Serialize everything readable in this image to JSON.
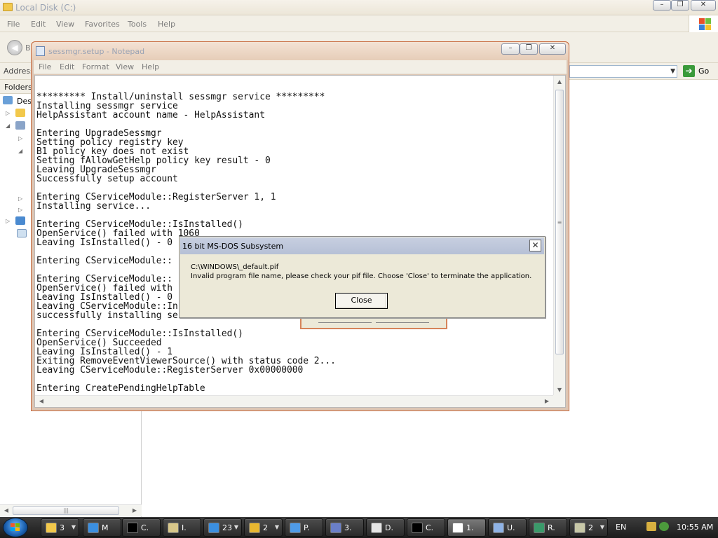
{
  "explorer": {
    "title": "Local Disk (C:)",
    "menu": [
      "File",
      "Edit",
      "View",
      "Favorites",
      "Tools",
      "Help"
    ],
    "back_label": "B",
    "address_label": "Address",
    "go_label": "Go",
    "folders_label": "Folders",
    "tree_first_label": "Des"
  },
  "notepad": {
    "title": "sessmgr.setup - Notepad",
    "menu": [
      "File",
      "Edit",
      "Format",
      "View",
      "Help"
    ],
    "lines": [
      "********* Install/uninstall sessmgr service *********",
      "Installing sessmgr service",
      "HelpAssistant account name - HelpAssistant",
      "",
      "Entering UpgradeSessmgr",
      "Setting policy registry key",
      "B1 policy key does not exist",
      "Setting fAllowGetHelp policy key result - 0",
      "Leaving UpgradeSessmgr",
      "Successfully setup account",
      "",
      "Entering CServiceModule::RegisterServer 1, 1",
      "Installing service...",
      "",
      "Entering CServiceModule::IsInstalled()",
      "OpenService() failed with 1060",
      "Leaving IsInstalled() - 0",
      "",
      "Entering CServiceModule::",
      "",
      "Entering CServiceModule::",
      "OpenService() failed with",
      "Leaving IsInstalled() - 0",
      "Leaving CServiceModule::In",
      "successfully installing service...",
      "",
      "Entering CServiceModule::IsInstalled()",
      "OpenService() Succeeded",
      "Leaving IsInstalled() - 1",
      "Exiting RemoveEventViewerSource() with status code 2...",
      "Leaving CServiceModule::RegisterServer 0x00000000",
      "",
      "Entering CreatePendingHelpTable"
    ]
  },
  "dialog": {
    "title": "16 bit MS-DOS Subsystem",
    "path": "C:\\WINDOWS\\_default.pif",
    "message": "Invalid program file name, please check your pif file. Choose 'Close' to terminate the application.",
    "close_button": "Close"
  },
  "taskbar": {
    "buttons": [
      {
        "label": "3",
        "icon": "folder-icon",
        "color": "#f2c84b",
        "dropdown": true
      },
      {
        "label": "M",
        "icon": "ie-icon",
        "color": "#3b8fe0",
        "dropdown": false
      },
      {
        "label": "C.",
        "icon": "cmd-icon",
        "color": "#000000",
        "dropdown": false
      },
      {
        "label": "I.",
        "icon": "document-icon",
        "color": "#d8c78a",
        "dropdown": false
      },
      {
        "label": "23",
        "icon": "ie-icon",
        "color": "#3b8fe0",
        "dropdown": true
      },
      {
        "label": "2",
        "icon": "folders-icon",
        "color": "#e8b730",
        "dropdown": true
      },
      {
        "label": "P.",
        "icon": "globe-icon",
        "color": "#4f9be8",
        "dropdown": false
      },
      {
        "label": "3.",
        "icon": "sphere-icon",
        "color": "#6a7fc8",
        "dropdown": false
      },
      {
        "label": "D.",
        "icon": "notepad-icon",
        "color": "#e6e6e6",
        "dropdown": false
      },
      {
        "label": "C.",
        "icon": "cmd-icon",
        "color": "#000000",
        "dropdown": false
      },
      {
        "label": "1.",
        "icon": "window-icon",
        "color": "#ffffff",
        "dropdown": false
      },
      {
        "label": "U.",
        "icon": "page-icon",
        "color": "#8fb3e6",
        "dropdown": false
      },
      {
        "label": "R.",
        "icon": "registry-icon",
        "color": "#3a9a6a",
        "dropdown": false
      },
      {
        "label": "2",
        "icon": "tool-icon",
        "color": "#c8c8a8",
        "dropdown": true
      }
    ],
    "language": "EN",
    "clock": "10:55 AM"
  }
}
